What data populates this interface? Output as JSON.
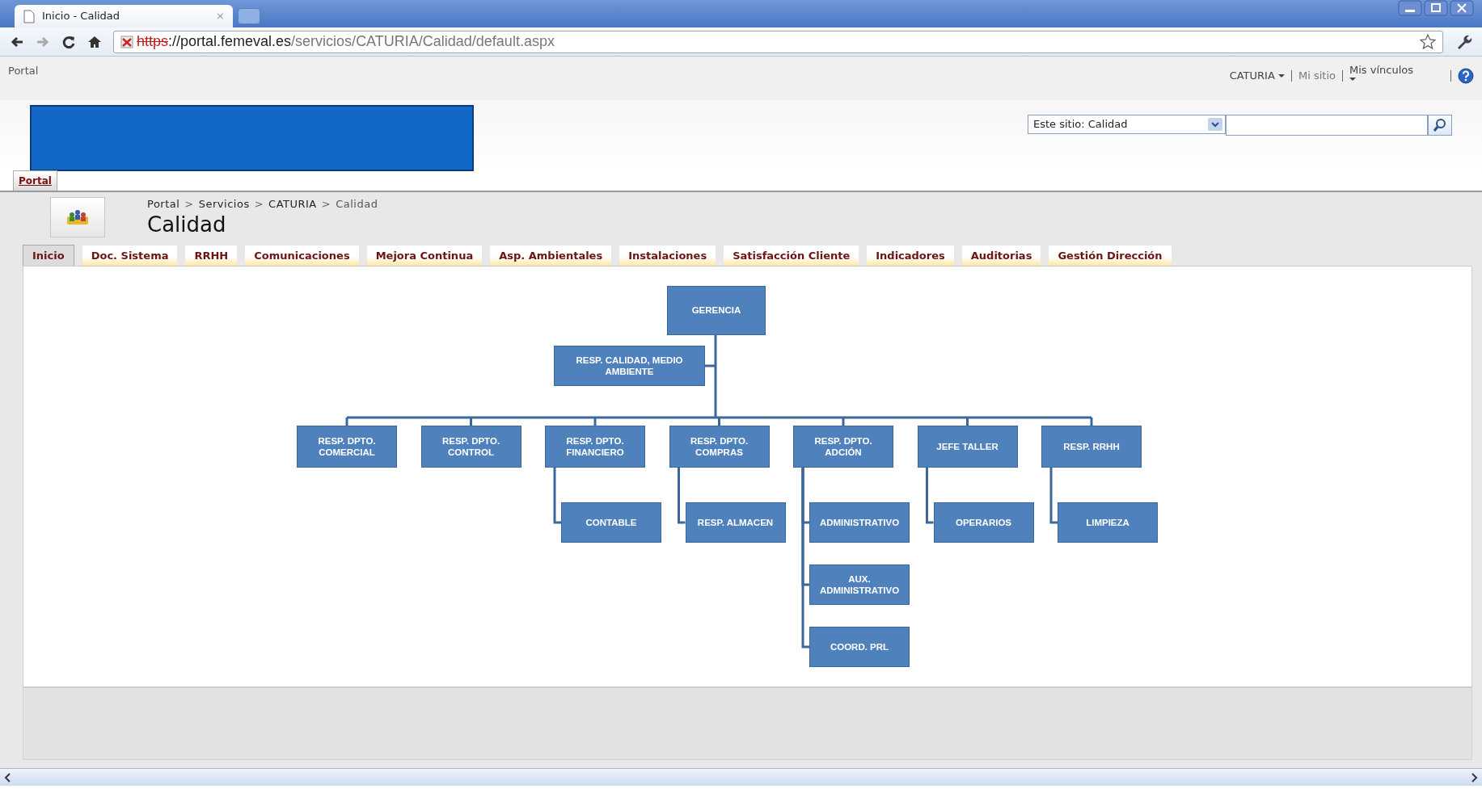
{
  "browser": {
    "tab_title": "Inicio - Calidad",
    "tab_close": "×",
    "url": {
      "scheme": "https",
      "host": "://portal.femeval.es",
      "path": "/servicios/CATURIA/Calidad/default.aspx"
    }
  },
  "top_bar": {
    "site": "Portal",
    "user_menu": "CATURIA",
    "my_site": "Mi sitio",
    "my_links": "Mis vínculos"
  },
  "search": {
    "scope": "Este sitio: Calidad"
  },
  "top_nav": [
    {
      "label": "Portal",
      "selected": true
    }
  ],
  "breadcrumb": {
    "separator": ">",
    "items": [
      "Portal",
      "Servicios",
      "CATURIA",
      "Calidad"
    ]
  },
  "page_title": "Calidad",
  "tabs": [
    {
      "label": "Inicio",
      "selected": true
    },
    {
      "label": "Doc. Sistema",
      "selected": false
    },
    {
      "label": "RRHH",
      "selected": false
    },
    {
      "label": "Comunicaciones",
      "selected": false
    },
    {
      "label": "Mejora Continua",
      "selected": false
    },
    {
      "label": "Asp. Ambientales",
      "selected": false
    },
    {
      "label": "Instalaciones",
      "selected": false
    },
    {
      "label": "Satisfacción Cliente",
      "selected": false
    },
    {
      "label": "Indicadores",
      "selected": false
    },
    {
      "label": "Auditorias",
      "selected": false
    },
    {
      "label": "Gestión Dirección",
      "selected": false
    }
  ],
  "org_chart": {
    "label": "GERENCIA",
    "children": [
      {
        "label": "RESP. CALIDAD, MEDIO AMBIENTE",
        "kind": "assistant"
      },
      {
        "label": "RESP. DPTO. COMERCIAL",
        "kind": "department"
      },
      {
        "label": "RESP. DPTO. CONTROL",
        "kind": "department"
      },
      {
        "label": "RESP. DPTO. FINANCIERO",
        "kind": "department",
        "children": [
          {
            "label": "CONTABLE"
          }
        ]
      },
      {
        "label": "RESP. DPTO. COMPRAS",
        "kind": "department",
        "children": [
          {
            "label": "RESP. ALMACEN"
          }
        ]
      },
      {
        "label": "RESP. DPTO. ADCIÓN",
        "kind": "department",
        "children": [
          {
            "label": "ADMINISTRATIVO"
          },
          {
            "label": "AUX. ADMINISTRATIVO"
          },
          {
            "label": "COORD. PRL"
          }
        ]
      },
      {
        "label": "JEFE TALLER",
        "kind": "department",
        "children": [
          {
            "label": "OPERARIOS"
          }
        ]
      },
      {
        "label": "RESP. RRHH",
        "kind": "department",
        "children": [
          {
            "label": "LIMPIEZA"
          }
        ]
      }
    ]
  }
}
